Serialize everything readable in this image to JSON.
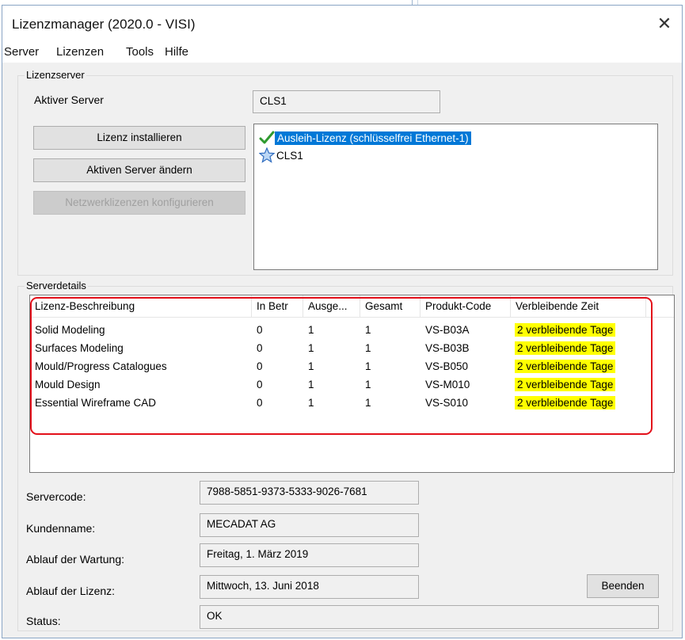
{
  "window": {
    "title": "Lizenzmanager (2020.0 - VISI)",
    "close_glyph": "✕"
  },
  "menu": {
    "items": [
      "Server",
      "Lizenzen",
      "Tools",
      "Hilfe"
    ]
  },
  "lizenzserver": {
    "group_label": "Lizenzserver",
    "active_server_label": "Aktiver Server",
    "active_server_value": "CLS1",
    "buttons": {
      "install": "Lizenz installieren",
      "change": "Aktiven Server ändern",
      "configure": "Netzwerklizenzen konfigurieren"
    },
    "list": [
      {
        "label": "Ausleih-Lizenz (schlüsselfrei Ethernet-1)",
        "icon": "checkmark-icon",
        "selected": true
      },
      {
        "label": "CLS1",
        "icon": "star-icon",
        "selected": false
      }
    ]
  },
  "serverdetails": {
    "group_label": "Serverdetails",
    "columns": [
      "Lizenz-Beschreibung",
      "In Betr",
      "Ausge...",
      "Gesamt",
      "Produkt-Code",
      "Verbleibende Zeit"
    ],
    "rows": [
      [
        "Solid Modeling",
        "0",
        "1",
        "1",
        "VS-B03A",
        "2 verbleibende Tage"
      ],
      [
        "Surfaces Modeling",
        "0",
        "1",
        "1",
        "VS-B03B",
        "2 verbleibende Tage"
      ],
      [
        "Mould/Progress Catalogues",
        "0",
        "1",
        "1",
        "VS-B050",
        "2 verbleibende Tage"
      ],
      [
        "Mould Design",
        "0",
        "1",
        "1",
        "VS-M010",
        "2 verbleibende Tage"
      ],
      [
        "Essential Wireframe CAD",
        "0",
        "1",
        "1",
        "VS-S010",
        "2 verbleibende Tage"
      ]
    ],
    "highlight_color": "#ffff00",
    "annotation_color": "#e3101a",
    "fields": {
      "servercode_label": "Servercode:",
      "servercode_value": "7988-5851-9373-5333-9026-7681",
      "kundenname_label": "Kundenname:",
      "kundenname_value": "MECADAT AG",
      "wartung_label": "Ablauf der Wartung:",
      "wartung_value": "Freitag, 1. März 2019",
      "lizenz_label": "Ablauf der Lizenz:",
      "lizenz_value": "Mittwoch, 13. Juni 2018",
      "status_label": "Status:",
      "status_value": "OK"
    },
    "exit_button": "Beenden"
  }
}
